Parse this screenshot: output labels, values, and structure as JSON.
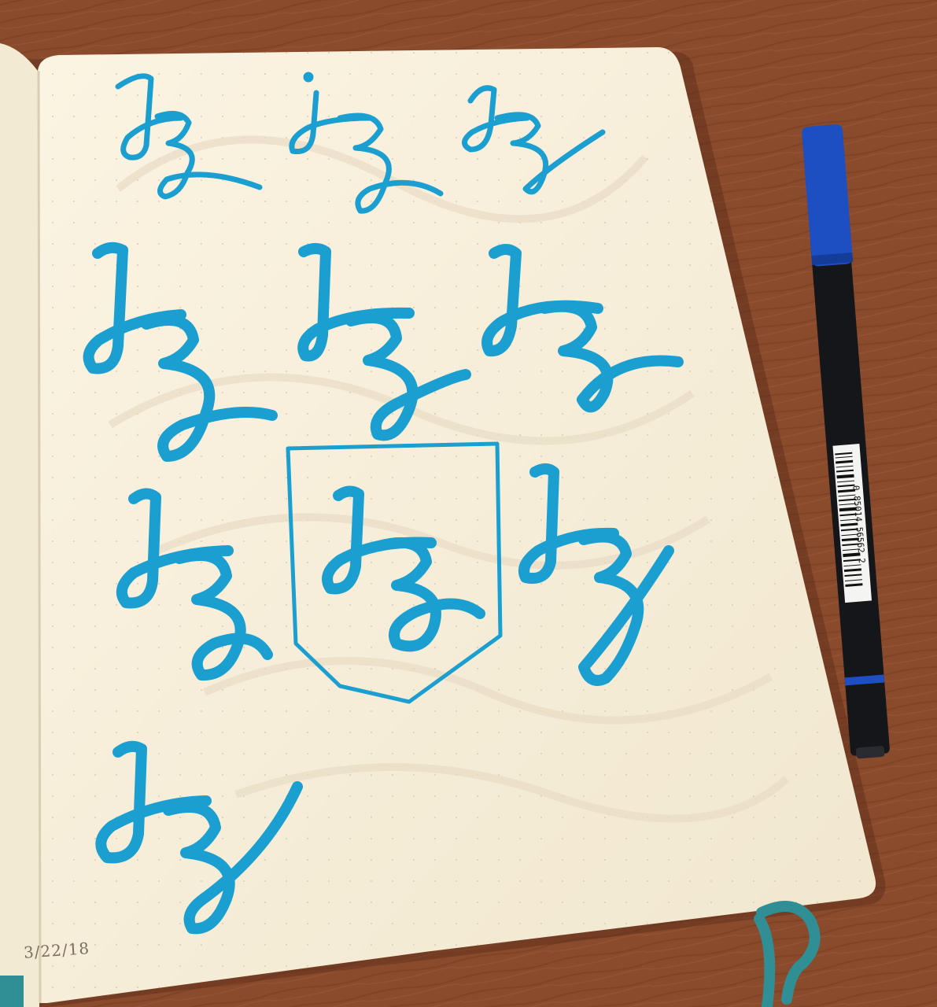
{
  "photo": {
    "subject": "",
    "colors": {
      "table": "#8a4a2c",
      "paper": "#f7efd9",
      "ink": "#1a9fd0",
      "pen_cap": "#1d4fc2",
      "pen_body": "#15161a",
      "ribbon": "#2f8f95"
    }
  },
  "page": {
    "date": "3/22/18",
    "barcode_digits": "0 85014 56562 2"
  }
}
